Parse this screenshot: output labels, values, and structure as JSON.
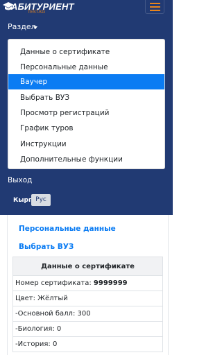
{
  "navbar": {
    "brand_text": "АБИТУРИЕНТ",
    "brand_sub": "TEST.KG",
    "section_label": "Раздел",
    "logout_label": "Выход",
    "lang_kyrg": "Кырг",
    "lang_rus": "Рус",
    "colors": {
      "navbar_bg": "#213a73",
      "accent": "#e8841c",
      "active_item": "#0b7cf3"
    }
  },
  "dropdown": {
    "items": [
      {
        "label": "Данные о сертификате"
      },
      {
        "label": "Персональные данные"
      },
      {
        "label": "Ваучер",
        "active": true
      },
      {
        "label": "Выбрать ВУЗ"
      },
      {
        "label": "Просмотр регистраций"
      },
      {
        "label": "График туров"
      },
      {
        "label": "Инструкции"
      },
      {
        "label": "Дополнительные функции"
      }
    ]
  },
  "content": {
    "link_personal": "Персональные данные",
    "link_choose_vuz": "Выбрать ВУЗ",
    "cert_title": "Данные о сертификате",
    "cert_number_label": "Номер сертификата:",
    "cert_number_value": "9999999",
    "color_row": "Цвет: Жёлтый",
    "base_score_row": "-Основной балл: 300",
    "biology_row": "-Биология: 0",
    "history_row": "-История: 0"
  },
  "icons": {
    "brand": "graduation-cap-icon",
    "menu": "hamburger-menu-icon",
    "section_caret": "caret-down-icon"
  }
}
